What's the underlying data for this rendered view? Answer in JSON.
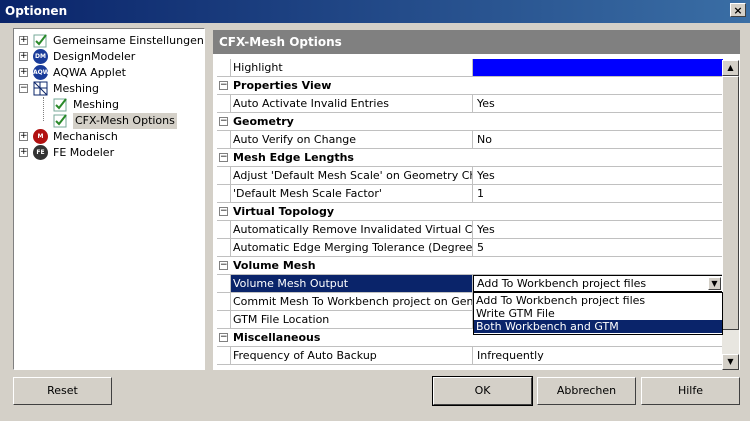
{
  "window": {
    "title": "Optionen",
    "close_label": "×"
  },
  "tree": [
    {
      "label": "Gemeinsame Einstellungen",
      "expander": "+",
      "icon": "check-icon"
    },
    {
      "label": "DesignModeler",
      "expander": "+",
      "icon": "dm-icon",
      "badge": "DM"
    },
    {
      "label": "AQWA Applet",
      "expander": "+",
      "icon": "aqwa-icon",
      "badge": "AQWA"
    },
    {
      "label": "Meshing",
      "expander": "−",
      "icon": "meshing-icon"
    },
    {
      "label": "Meshing",
      "icon": "check-icon"
    },
    {
      "label": "CFX-Mesh Options",
      "icon": "check-icon"
    },
    {
      "label": "Mechanisch",
      "expander": "+",
      "icon": "mech-icon",
      "badge": "M"
    },
    {
      "label": "FE Modeler",
      "expander": "+",
      "icon": "fe-icon",
      "badge": "FE"
    }
  ],
  "panel": {
    "header": "CFX-Mesh Options"
  },
  "rows": [
    {
      "type": "prop",
      "name": "Highlight",
      "value": "",
      "swatch": "#0000ff"
    },
    {
      "type": "cat",
      "name": "Properties View"
    },
    {
      "type": "prop",
      "name": "Auto Activate Invalid Entries",
      "value": "Yes"
    },
    {
      "type": "cat",
      "name": "Geometry"
    },
    {
      "type": "prop",
      "name": "Auto Verify on Change",
      "value": "No"
    },
    {
      "type": "cat",
      "name": "Mesh Edge Lengths"
    },
    {
      "type": "prop",
      "name": "Adjust 'Default Mesh Scale' on Geometry Change",
      "value": "Yes"
    },
    {
      "type": "prop",
      "name": "'Default Mesh Scale Factor'",
      "value": "1"
    },
    {
      "type": "cat",
      "name": "Virtual Topology"
    },
    {
      "type": "prop",
      "name": "Automatically Remove Invalidated Virtual Cells",
      "value": "Yes"
    },
    {
      "type": "prop",
      "name": "Automatic Edge Merging Tolerance (Degrees)",
      "value": "5"
    },
    {
      "type": "cat",
      "name": "Volume Mesh"
    },
    {
      "type": "combo",
      "name": "Volume Mesh Output",
      "value": "Add To Workbench project files"
    },
    {
      "type": "prop",
      "name": "Commit Mesh To Workbench project on Generate",
      "value": ""
    },
    {
      "type": "prop",
      "name": "GTM File Location",
      "value": ""
    },
    {
      "type": "cat",
      "name": "Miscellaneous"
    },
    {
      "type": "prop",
      "name": "Frequency of Auto Backup",
      "value": "Infrequently"
    }
  ],
  "dropdown": {
    "options": [
      "Add To Workbench project files",
      "Write GTM File",
      "Both Workbench and GTM"
    ],
    "selected_index": 2
  },
  "buttons": {
    "reset": "Reset",
    "ok": "OK",
    "cancel": "Abbrechen",
    "help": "Hilfe"
  }
}
